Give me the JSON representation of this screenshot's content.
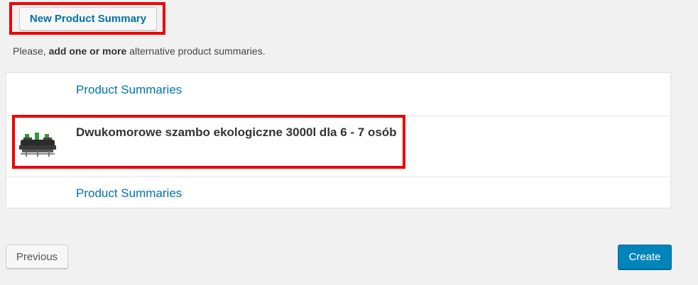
{
  "new_summary_button": "New Product Summary",
  "hint": {
    "prefix": "Please, ",
    "emphasis": "add one or more",
    "suffix": " alternative product summaries."
  },
  "rows": [
    {
      "kind": "link",
      "label": "Product Summaries"
    },
    {
      "kind": "product",
      "label": "Dwukomorowe szambo ekologiczne 3000l dla 6 - 7 osób",
      "thumbnail": "septic-tank-image"
    },
    {
      "kind": "link",
      "label": "Product Summaries"
    }
  ],
  "footer": {
    "previous_label": "Previous",
    "create_label": "Create"
  },
  "colors": {
    "link": "#0073aa",
    "primary_button": "#0085ba",
    "highlight": "#ef0000"
  }
}
